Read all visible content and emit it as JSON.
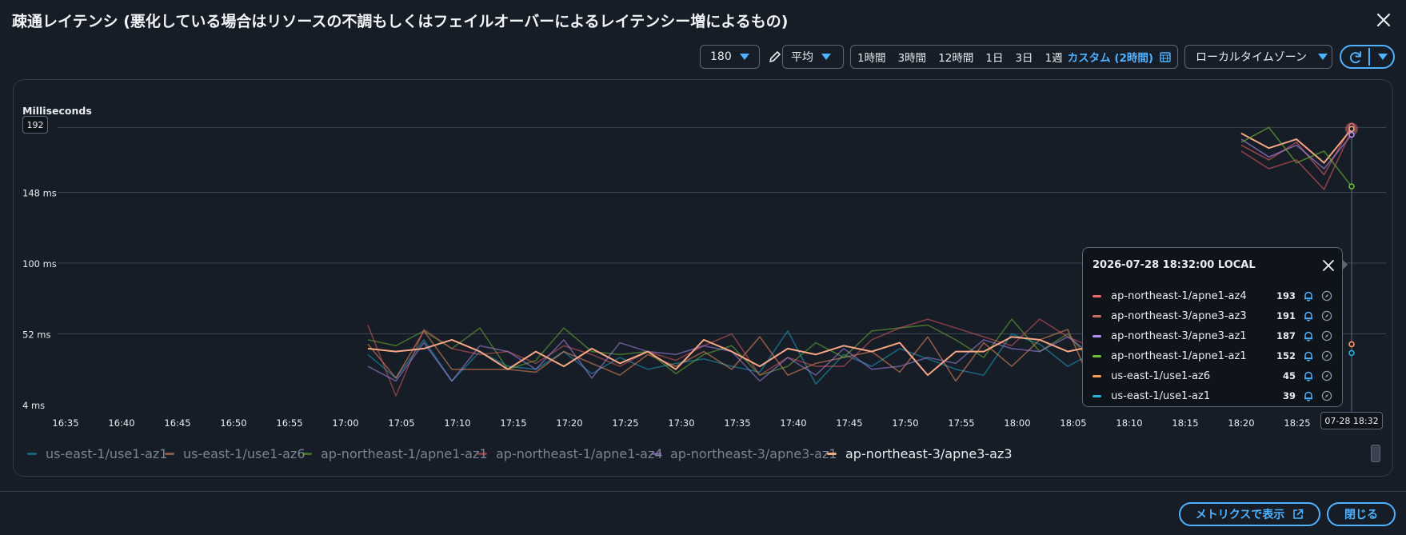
{
  "modal": {
    "title": "疎通レイテンシ (悪化している場合はリソースの不調もしくはフェイルオーバーによるレイテンシー増によるもの)",
    "close_icon": "close-icon"
  },
  "toolbar": {
    "period_value": "180",
    "stat_value": "平均",
    "time_ranges": [
      "1時間",
      "3時間",
      "12時間",
      "1日",
      "3日",
      "1週"
    ],
    "custom_range": "カスタム (2時間)",
    "timezone": "ローカルタイムゾーン"
  },
  "chart_data": {
    "type": "line",
    "ylabel": "Milliseconds",
    "y_ticks": [
      "4 ms",
      "52 ms",
      "100 ms",
      "148 ms",
      "192"
    ],
    "ylim": [
      4,
      196
    ],
    "x_ticks": [
      "16:35",
      "16:40",
      "16:45",
      "16:50",
      "16:55",
      "17:00",
      "17:05",
      "17:10",
      "17:15",
      "17:20",
      "17:25",
      "17:30",
      "17:35",
      "17:40",
      "17:45",
      "17:50",
      "17:55",
      "18:00",
      "18:05",
      "18:10",
      "18:15",
      "18:20",
      "18:25"
    ],
    "x_cursor_label": "07-28 18:32",
    "grid": true,
    "legend_placement": "bottom",
    "series": [
      {
        "name": "us-east-1/use1-az1",
        "color": "#1f9fbf",
        "visible": false,
        "start": "17:02",
        "values": [
          38,
          22,
          48,
          20,
          40,
          30,
          28,
          40,
          25,
          36,
          28,
          32,
          35,
          30,
          26,
          54,
          18,
          38,
          30,
          42,
          35,
          28,
          24,
          52,
          45,
          30,
          40,
          36
        ]
      },
      {
        "name": "us-east-1/use1-az6",
        "color": "#ef8d5d",
        "visible": false,
        "start": "17:02",
        "values": [
          45,
          22,
          54,
          28,
          28,
          28,
          26,
          40,
          32,
          24,
          38,
          30,
          40,
          28,
          50,
          24,
          32,
          36,
          40,
          26,
          50,
          20,
          46,
          30,
          48,
          55,
          12,
          52
        ]
      },
      {
        "name": "ap-northeast-1/apne1-az1",
        "color": "#6aaf35",
        "visible": false,
        "start": "17:02",
        "values": [
          48,
          44,
          54,
          42,
          56,
          28,
          34,
          56,
          40,
          38,
          40,
          25,
          38,
          44,
          24,
          30,
          46,
          36,
          54,
          56,
          58,
          48,
          36,
          62,
          40,
          52,
          30,
          44
        ]
      },
      {
        "name": "ap-northeast-1/apne1-az4",
        "color": "#d6585f",
        "visible": false,
        "start": "17:02",
        "values": [
          58,
          10,
          55,
          42,
          38,
          40,
          32,
          44,
          38,
          30,
          40,
          34,
          44,
          52,
          24,
          36,
          30,
          30,
          48,
          56,
          62,
          56,
          50,
          44,
          62,
          50,
          42,
          55
        ]
      },
      {
        "name": "ap-northeast-3/apne3-az1",
        "color": "#a883e8",
        "visible": false,
        "start": "17:02",
        "values": [
          30,
          20,
          46,
          20,
          44,
          40,
          28,
          48,
          22,
          46,
          40,
          38,
          44,
          40,
          20,
          36,
          24,
          42,
          28,
          30,
          36,
          32,
          48,
          42,
          40,
          50,
          36,
          42
        ]
      },
      {
        "name": "ap-northeast-3/apne3-az3",
        "color": "#f6a785",
        "visible": true,
        "start": "17:02",
        "values": [
          42,
          40,
          42,
          48,
          40,
          28,
          40,
          30,
          42,
          32,
          40,
          28,
          48,
          40,
          30,
          42,
          38,
          44,
          40,
          46,
          24,
          40,
          40,
          50,
          48,
          40,
          44,
          48
        ]
      }
    ],
    "tail": {
      "start": "18:20",
      "series": {
        "ap-northeast-1/apne1-az4": [
          180,
          170,
          182,
          160,
          193
        ],
        "ap-northeast-3/apne3-az3": [
          188,
          178,
          184,
          168,
          191
        ],
        "ap-northeast-3/apne3-az1": [
          184,
          172,
          180,
          164,
          187
        ],
        "ap-northeast-1/apne1-az1": [
          182,
          192,
          168,
          176,
          152
        ],
        "ap-northeast-1/apne1-az4b": [
          176,
          164,
          170,
          150,
          190
        ]
      }
    }
  },
  "legend": [
    {
      "name": "us-east-1/use1-az1",
      "color": "#1f9fbf",
      "on": false
    },
    {
      "name": "us-east-1/use1-az6",
      "color": "#ef8d5d",
      "on": false
    },
    {
      "name": "ap-northeast-1/apne1-az1",
      "color": "#6aaf35",
      "on": false
    },
    {
      "name": "ap-northeast-1/apne1-az4",
      "color": "#d6585f",
      "on": false
    },
    {
      "name": "ap-northeast-3/apne3-az1",
      "color": "#a883e8",
      "on": false
    },
    {
      "name": "ap-northeast-3/apne3-az3",
      "color": "#f6a785",
      "on": true
    }
  ],
  "tooltip": {
    "title": "2026-07-28 18:32:00 LOCAL",
    "rows": [
      {
        "name": "ap-northeast-1/apne1-az4",
        "value": "193",
        "color": "#f0636b"
      },
      {
        "name": "ap-northeast-3/apne3-az3",
        "value": "191",
        "color": "#c46c63"
      },
      {
        "name": "ap-northeast-3/apne3-az1",
        "value": "187",
        "color": "#b58ef0"
      },
      {
        "name": "ap-northeast-1/apne1-az1",
        "value": "152",
        "color": "#6dbf34"
      },
      {
        "name": "us-east-1/use1-az6",
        "value": "45",
        "color": "#ff9a5a"
      },
      {
        "name": "us-east-1/use1-az1",
        "value": "39",
        "color": "#23b3d9"
      }
    ]
  },
  "footer": {
    "view_in_metrics": "メトリクスで表示",
    "close": "閉じる"
  }
}
